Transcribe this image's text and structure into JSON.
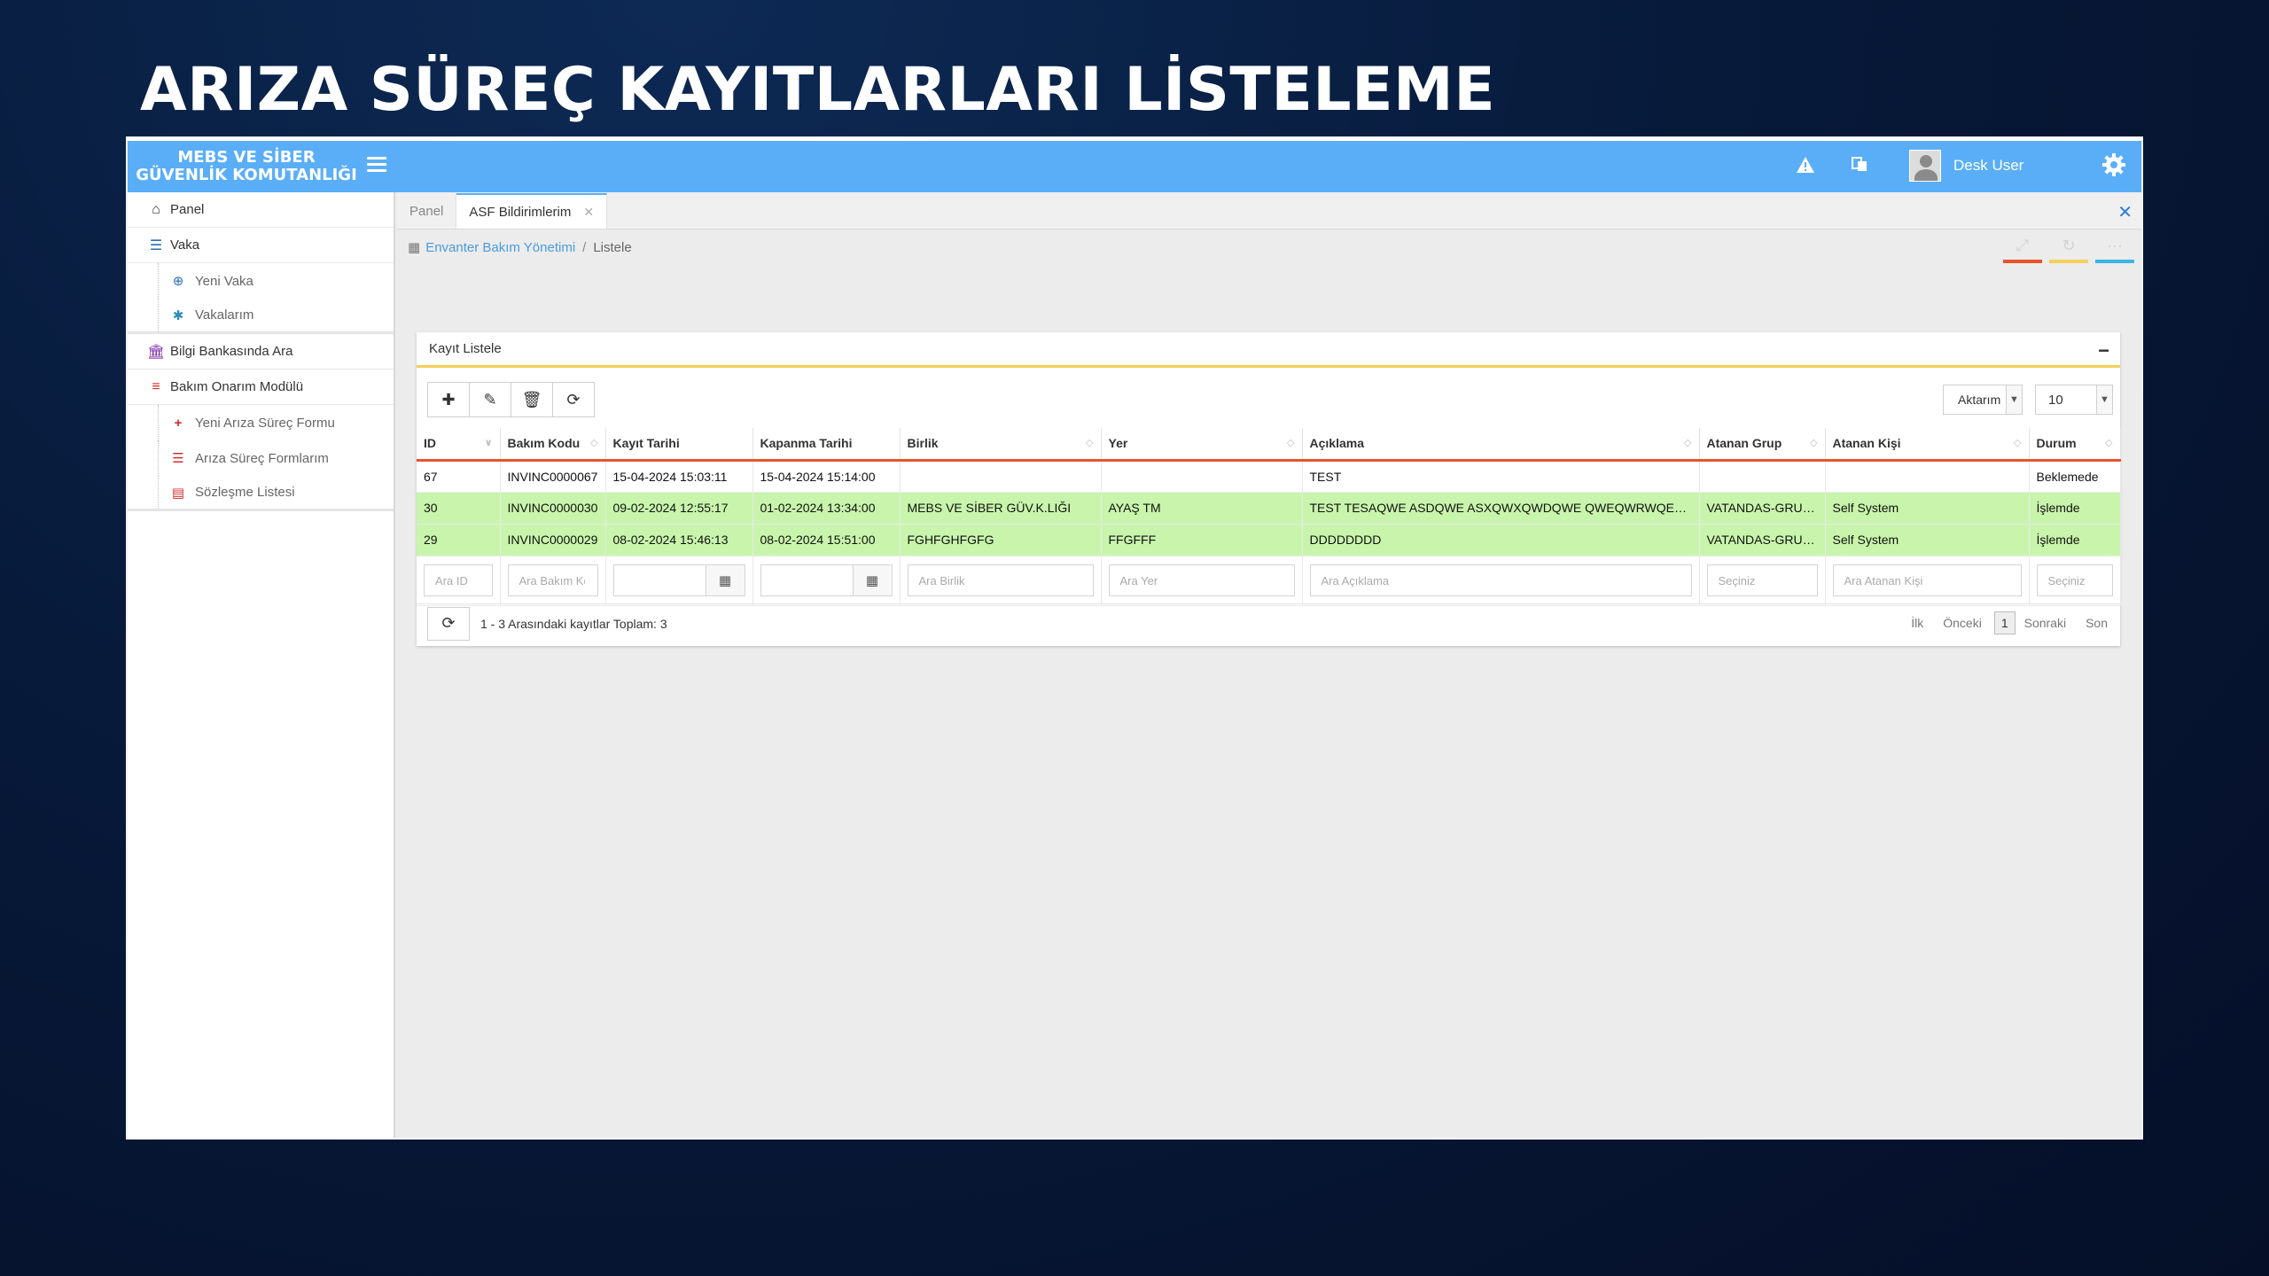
{
  "slide": {
    "title": "ARIZA SÜREÇ KAYITLARLARI LİSTELEME"
  },
  "header": {
    "brand_line1": "MEBS VE SİBER",
    "brand_line2": "GÜVENLİK KOMUTANLIĞI",
    "user_name": "Desk User",
    "accent_color": "#5aaef7"
  },
  "sidebar": {
    "items": [
      {
        "label": "Panel",
        "icon": "home-icon"
      },
      {
        "label": "Vaka",
        "icon": "list-icon"
      },
      {
        "label": "Yeni Vaka",
        "icon": "plus-circle-icon"
      },
      {
        "label": "Vakalarım",
        "icon": "asterisk-icon"
      },
      {
        "label": "Bilgi Bankasında Ara",
        "icon": "bank-icon"
      },
      {
        "label": "Bakım Onarım Modülü",
        "icon": "database-icon"
      },
      {
        "label": "Yeni Arıza Süreç Formu",
        "icon": "plus-icon"
      },
      {
        "label": "Arıza Süreç Formlarım",
        "icon": "list-icon"
      },
      {
        "label": "Sözleşme Listesi",
        "icon": "pdf-file-icon"
      }
    ]
  },
  "tabs": [
    {
      "label": "Panel"
    },
    {
      "label": "ASF Bildirimlerim"
    }
  ],
  "breadcrumb": {
    "parent": "Envanter Bakım Yönetimi",
    "sep": "/",
    "current": "Listele"
  },
  "panel": {
    "title": "Kayıt Listele",
    "export_label": "Aktarım",
    "page_size": "10"
  },
  "table": {
    "columns": [
      "ID",
      "Bakım Kodu",
      "Kayıt Tarihi",
      "Kapanma Tarihi",
      "Birlik",
      "Yer",
      "Açıklama",
      "Atanan Grup",
      "Atanan Kişi",
      "Durum"
    ],
    "rows": [
      [
        "67",
        "INVINC0000067",
        "15-04-2024 15:03:11",
        "15-04-2024 15:14:00",
        "",
        "",
        "TEST",
        "",
        "",
        "Beklemede"
      ],
      [
        "30",
        "INVINC0000030",
        "09-02-2024 12:55:17",
        "01-02-2024 13:34:00",
        "MEBS VE SİBER GÜV.K.LIĞI",
        "AYAŞ TM",
        "TEST TESAQWE ASDQWE ASXQWXQWDQWE QWEQWRWQEWQ",
        "VATANDAS-GRUBU",
        "Self System",
        "İşlemde"
      ],
      [
        "29",
        "INVINC0000029",
        "08-02-2024 15:46:13",
        "08-02-2024 15:51:00",
        "FGHFGHFGFG",
        "FFGFFF",
        "DDDDDDDD",
        "VATANDAS-GRUBU",
        "Self System",
        "İşlemde"
      ]
    ],
    "filters": [
      "Ara ID",
      "Ara Bakım Kodu",
      "",
      "",
      "Ara Birlik",
      "Ara Yer",
      "Ara Açıklama",
      "Seçiniz",
      "Ara Atanan Kişi",
      "Seçiniz"
    ]
  },
  "footer": {
    "summary": "1 - 3 Arasındaki kayıtlar Toplam: 3",
    "first": "İlk",
    "prev": "Önceki",
    "page": "1",
    "next": "Sonraki",
    "last": "Son"
  }
}
